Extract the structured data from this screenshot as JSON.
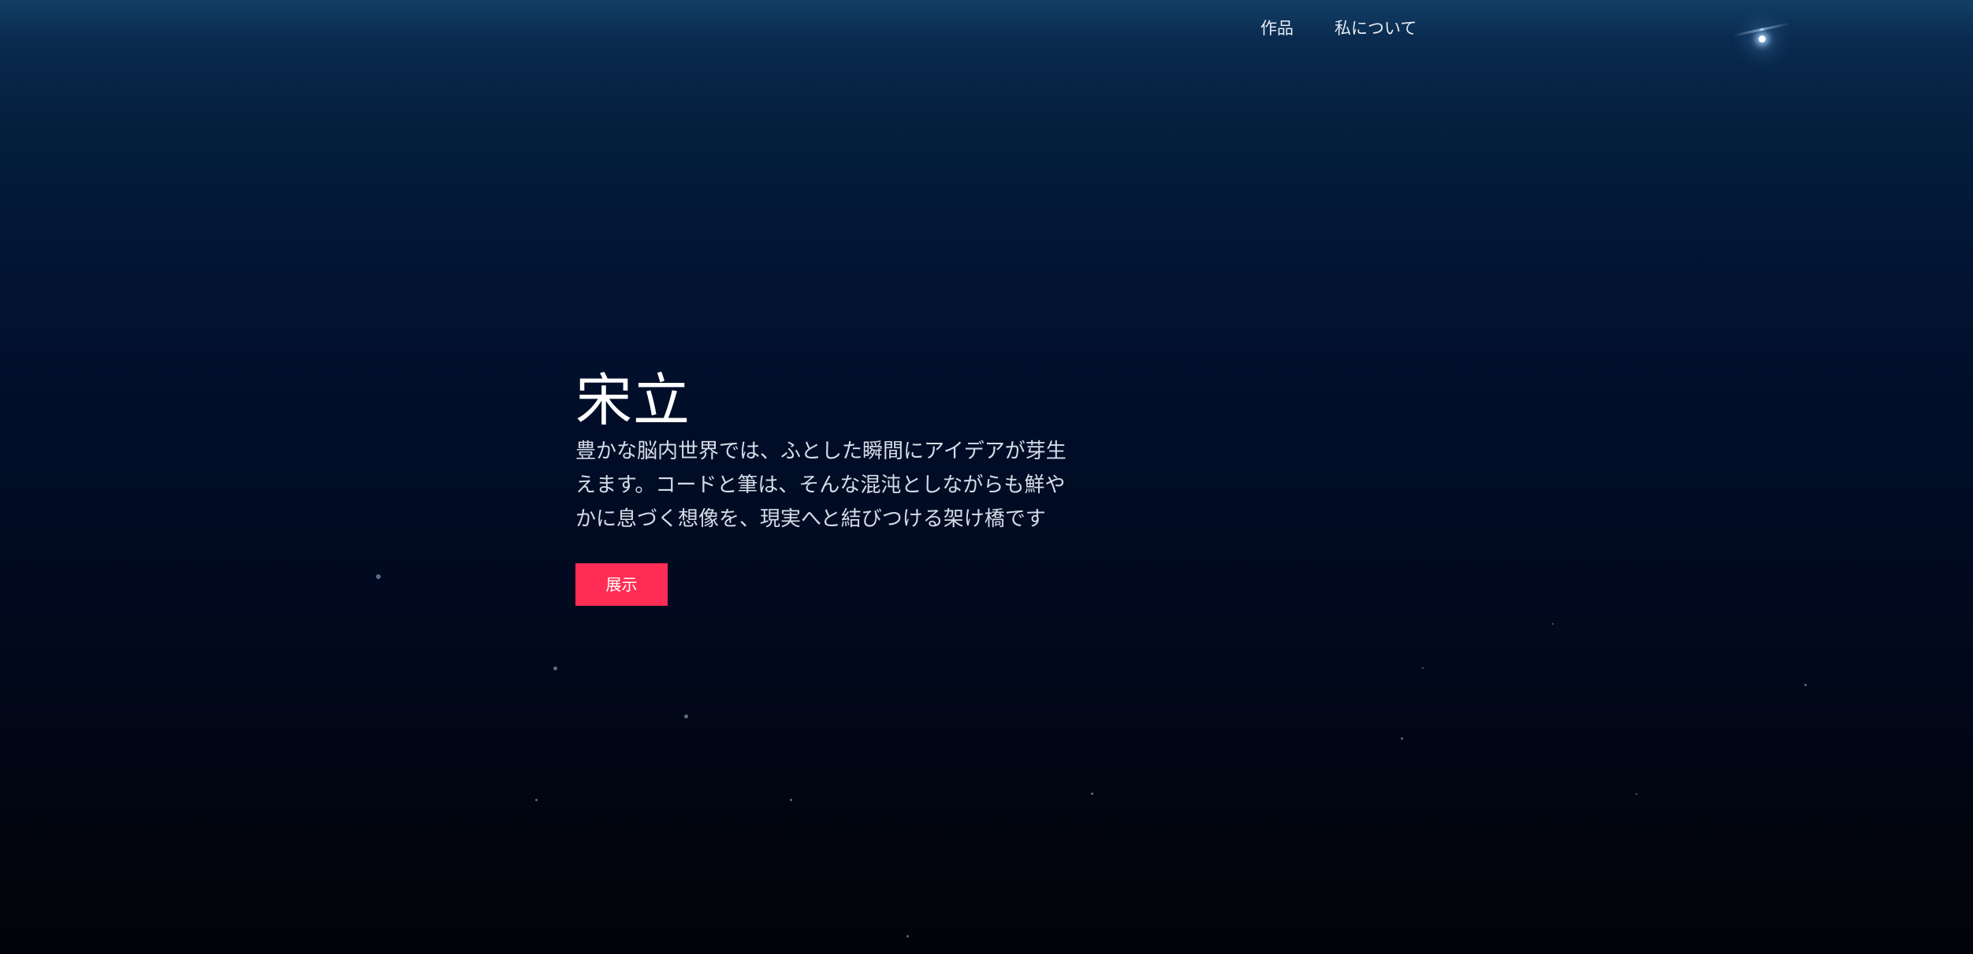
{
  "nav": {
    "items": [
      {
        "label": "作品"
      },
      {
        "label": "私について"
      }
    ]
  },
  "hero": {
    "title": "宋立",
    "description": "豊かな脳内世界では、ふとした瞬間にアイデアが芽生えます。コードと筆は、そんな混沌としながらも鮮やかに息づく想像を、現実へと結びつける架け橋です",
    "button_label": "展示"
  },
  "colors": {
    "accent": "#ff2d55",
    "background_top": "#123f66",
    "background_bottom": "#020308"
  }
}
